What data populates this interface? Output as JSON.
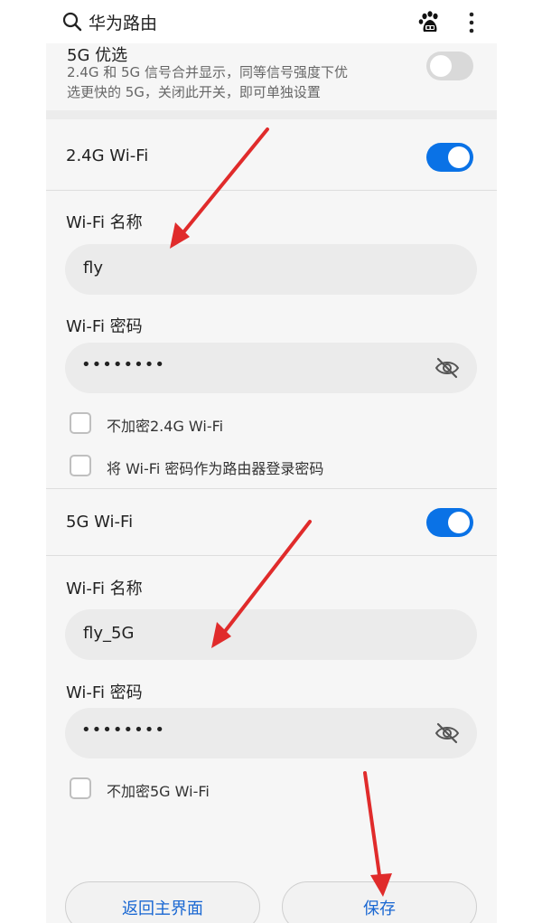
{
  "topbar": {
    "title": "华为路由",
    "icons": [
      "search-icon",
      "baidu-paw-icon",
      "more-vertical-icon"
    ]
  },
  "prefer_5g": {
    "title": "5G 优选",
    "description_line1": "2.4G 和 5G 信号合并显示，同等信号强度下优",
    "description_line2": "选更快的 5G，关闭此开关，即可单独设置",
    "enabled": false
  },
  "wifi_24g": {
    "title": "2.4G Wi-Fi",
    "enabled": true,
    "name_label": "Wi-Fi 名称",
    "name_value": "fly",
    "password_label": "Wi-Fi 密码",
    "password_mask": "••••••••",
    "no_encrypt_label": "不加密2.4G Wi-Fi",
    "use_as_login_label": "将 Wi-Fi 密码作为路由器登录密码"
  },
  "wifi_5g": {
    "title": "5G Wi-Fi",
    "enabled": true,
    "name_label": "Wi-Fi 名称",
    "name_value": "fly_5G",
    "password_label": "Wi-Fi 密码",
    "password_mask": "••••••••",
    "no_encrypt_label": "不加密5G Wi-Fi"
  },
  "actions": {
    "back_label": "返回主界面",
    "save_label": "保存"
  },
  "colors": {
    "accent": "#0a72e6",
    "link": "#1967d2",
    "annotation": "#e02b2b"
  }
}
